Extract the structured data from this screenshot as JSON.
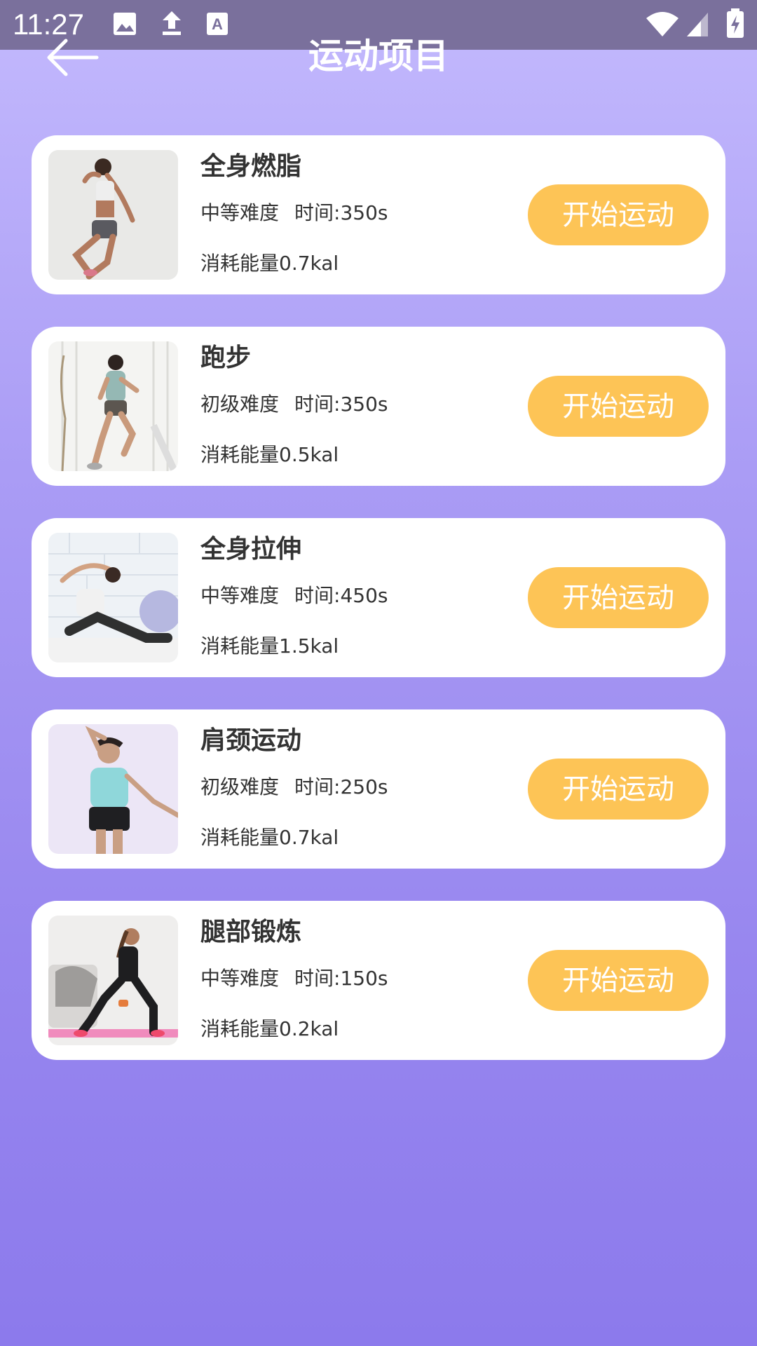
{
  "status_bar": {
    "time": "11:27"
  },
  "header": {
    "title": "运动项目",
    "back_icon": "arrow-left-icon"
  },
  "exercises": [
    {
      "name": "全身燃脂",
      "difficulty": "中等难度",
      "time": "时间:350s",
      "energy": "消耗能量0.7kal",
      "button": "开始运动",
      "image": "woman-running-pose"
    },
    {
      "name": "跑步",
      "difficulty": "初级难度",
      "time": "时间:350s",
      "energy": "消耗能量0.5kal",
      "button": "开始运动",
      "image": "man-running-treadmill"
    },
    {
      "name": "全身拉伸",
      "difficulty": "中等难度",
      "time": "时间:450s",
      "energy": "消耗能量1.5kal",
      "button": "开始运动",
      "image": "woman-stretching"
    },
    {
      "name": "肩颈运动",
      "difficulty": "初级难度",
      "time": "时间:250s",
      "energy": "消耗能量0.7kal",
      "button": "开始运动",
      "image": "woman-neck-stretch"
    },
    {
      "name": "腿部锻炼",
      "difficulty": "中等难度",
      "time": "时间:150s",
      "energy": "消耗能量0.2kal",
      "button": "开始运动",
      "image": "woman-lunge-dumbbells"
    }
  ],
  "colors": {
    "button": "#fdc456",
    "status_bar": "#7a709c",
    "background_top": "#c3b9fd",
    "background_bottom": "#8c7aec"
  }
}
